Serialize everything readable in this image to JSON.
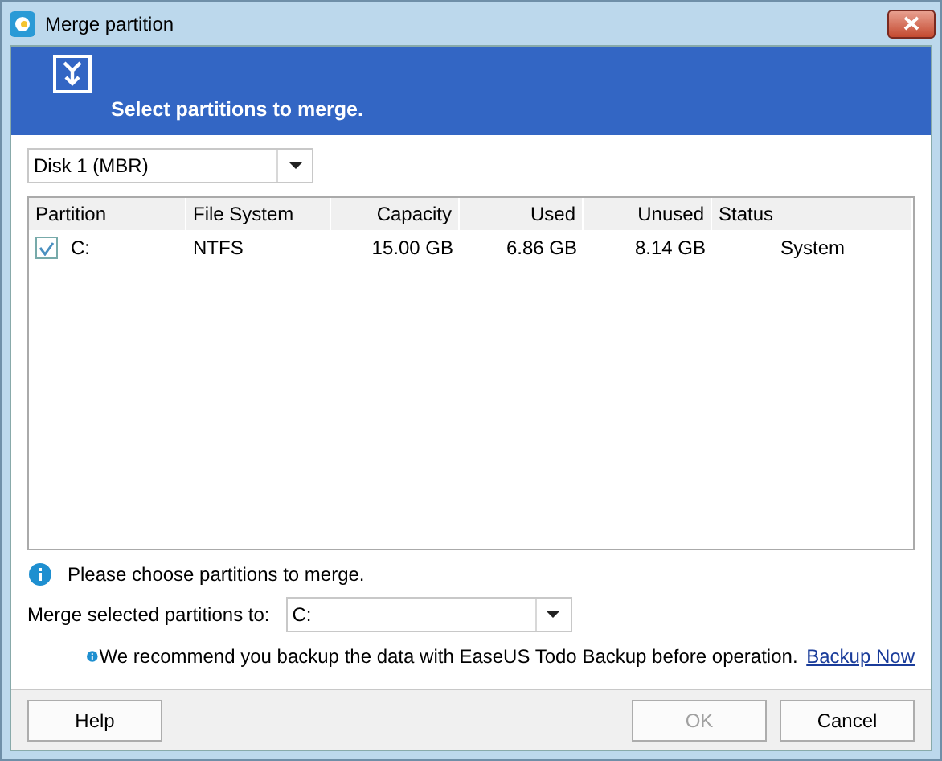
{
  "window": {
    "title": "Merge partition"
  },
  "banner": {
    "heading": "Select partitions to merge."
  },
  "disk_select": {
    "value": "Disk 1 (MBR)"
  },
  "table": {
    "columns": [
      "Partition",
      "File System",
      "Capacity",
      "Used",
      "Unused",
      "Status"
    ],
    "rows": [
      {
        "checked": true,
        "cells": [
          "C:",
          "NTFS",
          "15.00 GB",
          "6.86 GB",
          "8.14 GB",
          "System"
        ]
      }
    ]
  },
  "hint": "Please choose partitions to merge.",
  "merge_to": {
    "label": "Merge selected partitions to:",
    "value": "C:"
  },
  "recommend": {
    "text": "We recommend you backup the data with EaseUS Todo Backup before operation.",
    "link": "Backup Now"
  },
  "buttons": [
    {
      "label": "Help",
      "disabled": false
    },
    {
      "label": "OK",
      "disabled": true
    },
    {
      "label": "Cancel",
      "disabled": false
    }
  ]
}
